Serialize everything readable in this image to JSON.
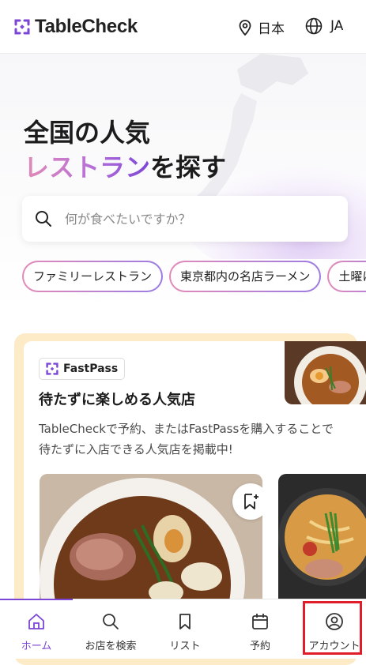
{
  "header": {
    "brand": "TableCheck",
    "region_label": "日本",
    "language_label": "JA"
  },
  "hero": {
    "title_line1": "全国の人気",
    "title_line2_highlight": "レストラン",
    "title_line2_rest": "を探す",
    "search_placeholder": "何が食べたいですか？"
  },
  "chips": [
    "ファミリーレストラン",
    "東京都内の名店ラーメン",
    "土曜に行"
  ],
  "feature_card": {
    "badge": "FastPass",
    "title": "待たずに楽しめる人気店",
    "description": "TableCheckで予約、またはFastPassを購入することで待たずに入店できる人気店を掲載中!"
  },
  "tabbar": {
    "items": [
      {
        "label": "ホーム",
        "icon": "home-icon",
        "active": true
      },
      {
        "label": "お店を検索",
        "icon": "search-icon",
        "active": false
      },
      {
        "label": "リスト",
        "icon": "bookmark-icon",
        "active": false
      },
      {
        "label": "予約",
        "icon": "calendar-icon",
        "active": false
      },
      {
        "label": "アカウント",
        "icon": "account-icon",
        "active": false
      }
    ]
  },
  "colors": {
    "brand_purple": "#7b46d6",
    "gradient_pink": "#e38ab7",
    "card_background": "#fdebc8",
    "highlight_red": "#e11d2a"
  }
}
